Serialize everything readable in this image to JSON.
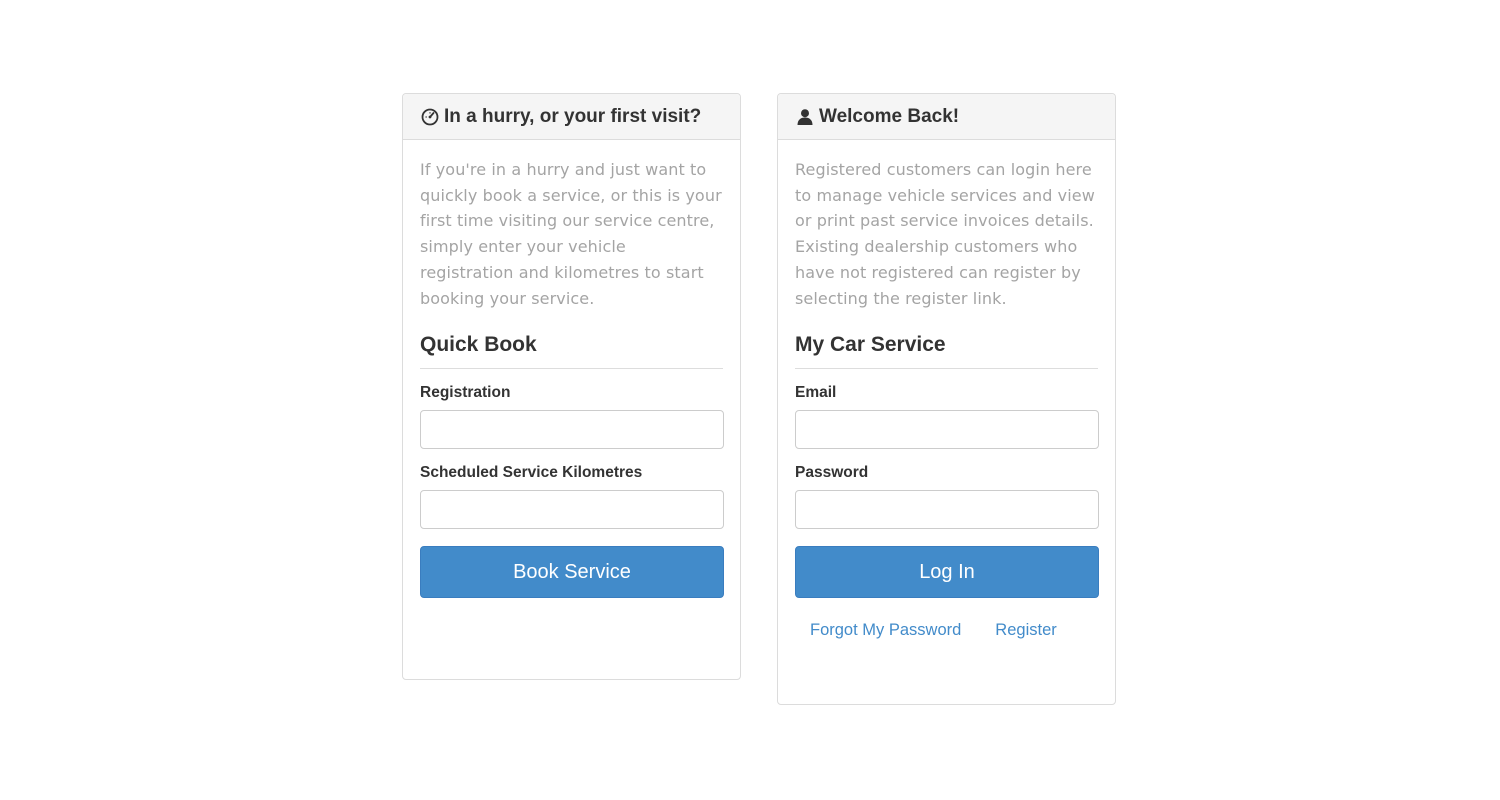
{
  "quick_panel": {
    "title": "In a hurry, or your first visit?",
    "icon": "dashboard-gauge-icon",
    "intro": "If you're in a hurry and just want to quickly book a service, or this is your first time visiting our service centre, simply enter your vehicle registration and kilometres to start booking your service.",
    "section_title": "Quick Book",
    "registration_label": "Registration",
    "registration_value": "",
    "kilometres_label": "Scheduled Service Kilometres",
    "kilometres_value": "",
    "button_label": "Book Service"
  },
  "login_panel": {
    "title": "Welcome Back!",
    "icon": "user-icon",
    "intro": "Registered customers can login here to manage vehicle services and view or print past service invoices details. Existing dealership customers who have not registered can register by selecting the register link.",
    "section_title": "My Car Service",
    "email_label": "Email",
    "email_value": "",
    "password_label": "Password",
    "password_value": "",
    "button_label": "Log In",
    "forgot_link": "Forgot My Password",
    "register_link": "Register"
  },
  "colors": {
    "primary": "#428bca",
    "link": "#428bca",
    "heading_bg": "#f5f5f5",
    "muted_text": "#a4a4a4"
  }
}
